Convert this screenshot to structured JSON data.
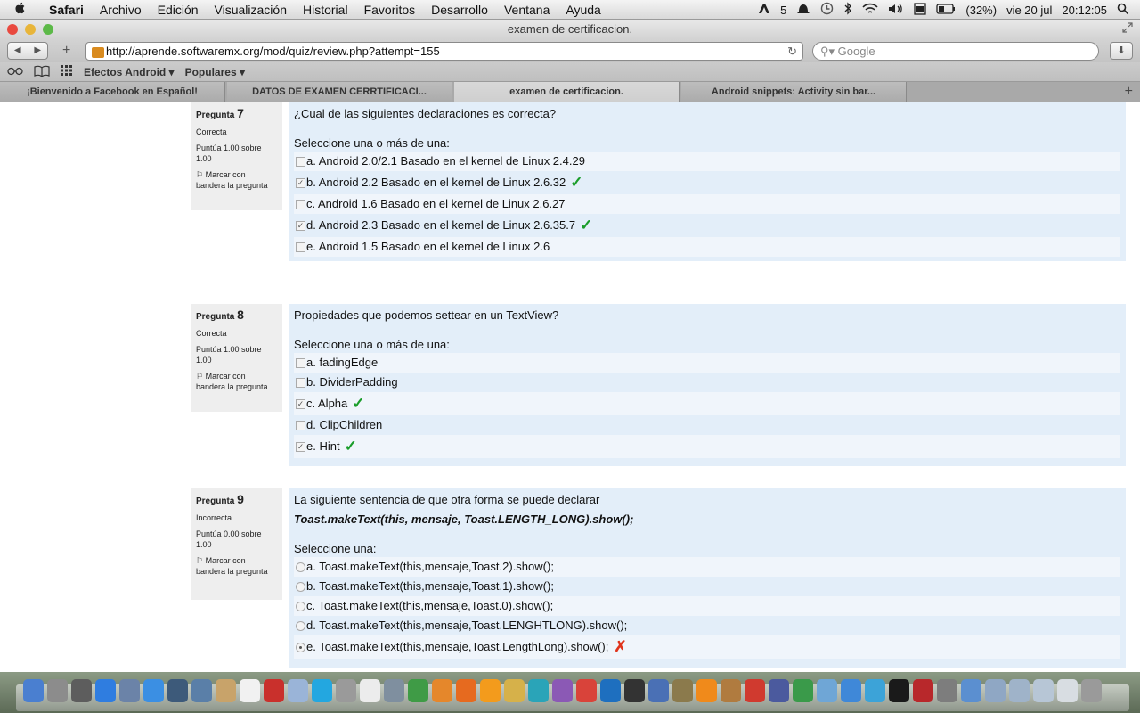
{
  "menubar": {
    "apple": "",
    "app": "Safari",
    "items": [
      "Archivo",
      "Edición",
      "Visualización",
      "Historial",
      "Favoritos",
      "Desarrollo",
      "Ventana",
      "Ayuda"
    ],
    "status": {
      "adobe": "5",
      "battery": "(32%)",
      "date": "vie 20 jul",
      "time": "20:12:05"
    }
  },
  "window": {
    "title": "examen de certificacion."
  },
  "toolbar": {
    "url": "http://aprende.softwaremx.org/mod/quiz/review.php?attempt=155",
    "search_placeholder": "Google"
  },
  "bookmarks": {
    "items": [
      "Efectos Android ▾",
      "Populares ▾"
    ]
  },
  "tabs": {
    "items": [
      {
        "label": "¡Bienvenido a Facebook en Español!"
      },
      {
        "label": "DATOS DE EXAMEN CERRTIFICACI..."
      },
      {
        "label": "examen de certificacion."
      },
      {
        "label": "Android snippets: Activity sin bar..."
      }
    ],
    "active_index": 2
  },
  "questions": [
    {
      "number_prefix": "Pregunta",
      "number": "7",
      "status": "Correcta",
      "score": "Puntúa 1.00 sobre 1.00",
      "flag": "Marcar con bandera la pregunta",
      "text": "¿Cual de las siguientes declaraciones es correcta?",
      "prompt": "Seleccione una o más de una:",
      "options": [
        {
          "label": "a. Android 2.0/2.1 Basado en el kernel de Linux 2.4.29",
          "checked": false,
          "mark": ""
        },
        {
          "label": "b. Android 2.2 Basado en el kernel de Linux 2.6.32",
          "checked": true,
          "mark": "✓"
        },
        {
          "label": "c. Android 1.6 Basado en el kernel de Linux 2.6.27",
          "checked": false,
          "mark": ""
        },
        {
          "label": "d. Android 2.3 Basado en el kernel de Linux 2.6.35.7",
          "checked": true,
          "mark": "✓"
        },
        {
          "label": "e. Android 1.5 Basado en el kernel de Linux 2.6",
          "checked": false,
          "mark": ""
        }
      ]
    },
    {
      "number_prefix": "Pregunta",
      "number": "8",
      "status": "Correcta",
      "score": "Puntúa 1.00 sobre 1.00",
      "flag": "Marcar con bandera la pregunta",
      "text": "Propiedades que podemos settear en un TextView?",
      "prompt": "Seleccione una o más de una:",
      "options": [
        {
          "label": "a. fadingEdge",
          "checked": false,
          "mark": ""
        },
        {
          "label": "b. DividerPadding",
          "checked": false,
          "mark": ""
        },
        {
          "label": "c. Alpha",
          "checked": true,
          "mark": "✓"
        },
        {
          "label": "d. ClipChildren",
          "checked": false,
          "mark": ""
        },
        {
          "label": "e. Hint",
          "checked": true,
          "mark": "✓"
        }
      ]
    },
    {
      "number_prefix": "Pregunta",
      "number": "9",
      "status": "Incorrecta",
      "score": "Puntúa 0.00 sobre 1.00",
      "flag": "Marcar con bandera la pregunta",
      "text": "La siguiente sentencia de que otra forma se puede declarar",
      "code": "Toast.makeText(this, mensaje, Toast.LENGTH_LONG).show();",
      "prompt": "Seleccione una:",
      "options": [
        {
          "label": "a. Toast.makeText(this,mensaje,Toast.2).show();",
          "checked": false,
          "mark": ""
        },
        {
          "label": "b. Toast.makeText(this,mensaje,Toast.1).show();",
          "checked": false,
          "mark": ""
        },
        {
          "label": "c. Toast.makeText(this,mensaje,Toast.0).show();",
          "checked": false,
          "mark": ""
        },
        {
          "label": "d. Toast.makeText(this,mensaje,Toast.LENGHTLONG).show();",
          "checked": false,
          "mark": ""
        },
        {
          "label": "e. Toast.makeText(this,mensaje,Toast.LengthLong).show();",
          "checked": true,
          "mark": "✗"
        }
      ]
    }
  ],
  "colors": {
    "question_bg": "#e3eef9",
    "info_bg": "#eeeeee",
    "correct": "#1a9d2a",
    "incorrect": "#e0341c"
  }
}
